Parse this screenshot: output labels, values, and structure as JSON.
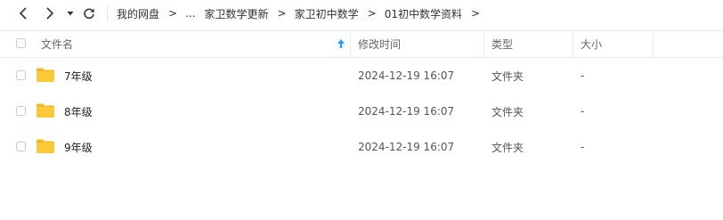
{
  "toolbar": {
    "breadcrumb": {
      "root": "我的网盘",
      "ellipsis": "...",
      "items": [
        "家卫数学更新",
        "家卫初中数学",
        "01初中数学资料"
      ],
      "separator": ">"
    }
  },
  "table": {
    "columns": {
      "name": "文件名",
      "modified": "修改时间",
      "type": "类型",
      "size": "大小"
    },
    "sort": {
      "column": "name",
      "direction": "ascending"
    },
    "rows": [
      {
        "name": "7年级",
        "modified": "2024-12-19 16:07",
        "type": "文件夹",
        "size": "-"
      },
      {
        "name": "8年级",
        "modified": "2024-12-19 16:07",
        "type": "文件夹",
        "size": "-"
      },
      {
        "name": "9年级",
        "modified": "2024-12-19 16:07",
        "type": "文件夹",
        "size": "-"
      }
    ]
  },
  "colors": {
    "accent": "#2e9bf0",
    "folder_fill": "#fcc93b",
    "folder_tab": "#f6b526"
  },
  "icons": {
    "back": "chevron-left-icon",
    "forward": "chevron-right-icon",
    "history": "caret-down-icon",
    "refresh": "refresh-icon",
    "sort": "sort-ascending-icon",
    "folder": "folder-icon"
  }
}
